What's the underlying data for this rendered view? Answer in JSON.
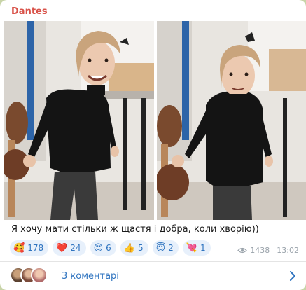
{
  "post": {
    "author": "Dantes",
    "caption": "Я хочу мати стільки ж щастя і добра, коли хворію))",
    "views": "1438",
    "time": "13:02"
  },
  "reactions": [
    {
      "emoji": "🥰",
      "icon": "smiling-face-with-hearts-icon",
      "count": "178"
    },
    {
      "emoji": "❤️",
      "icon": "red-heart-icon",
      "count": "24"
    },
    {
      "emoji": "😍",
      "icon": "heart-eyes-icon",
      "count": "6"
    },
    {
      "emoji": "👍",
      "icon": "thumbs-up-icon",
      "count": "5"
    },
    {
      "emoji": "😇",
      "icon": "halo-face-icon",
      "count": "2"
    },
    {
      "emoji": "💘",
      "icon": "heart-with-arrow-icon",
      "count": "1"
    }
  ],
  "comments": {
    "label": "3 коментарі"
  },
  "colors": {
    "author": "#d9534a",
    "accent": "#2f74c0",
    "reaction_bg": "#e7f0fb",
    "meta": "#9aa3ab"
  }
}
